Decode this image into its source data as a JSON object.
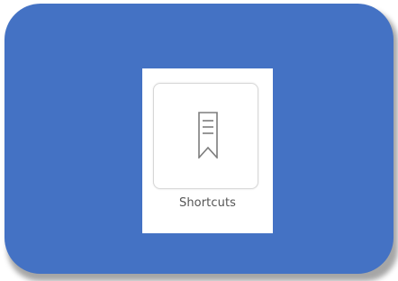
{
  "highlight": {
    "color": "#4472c4"
  },
  "shortcut_tile": {
    "label": "Shortcuts",
    "icon": "bookmark-icon",
    "icon_color": "#7d7d7d",
    "border_color": "#d7d7d7"
  }
}
